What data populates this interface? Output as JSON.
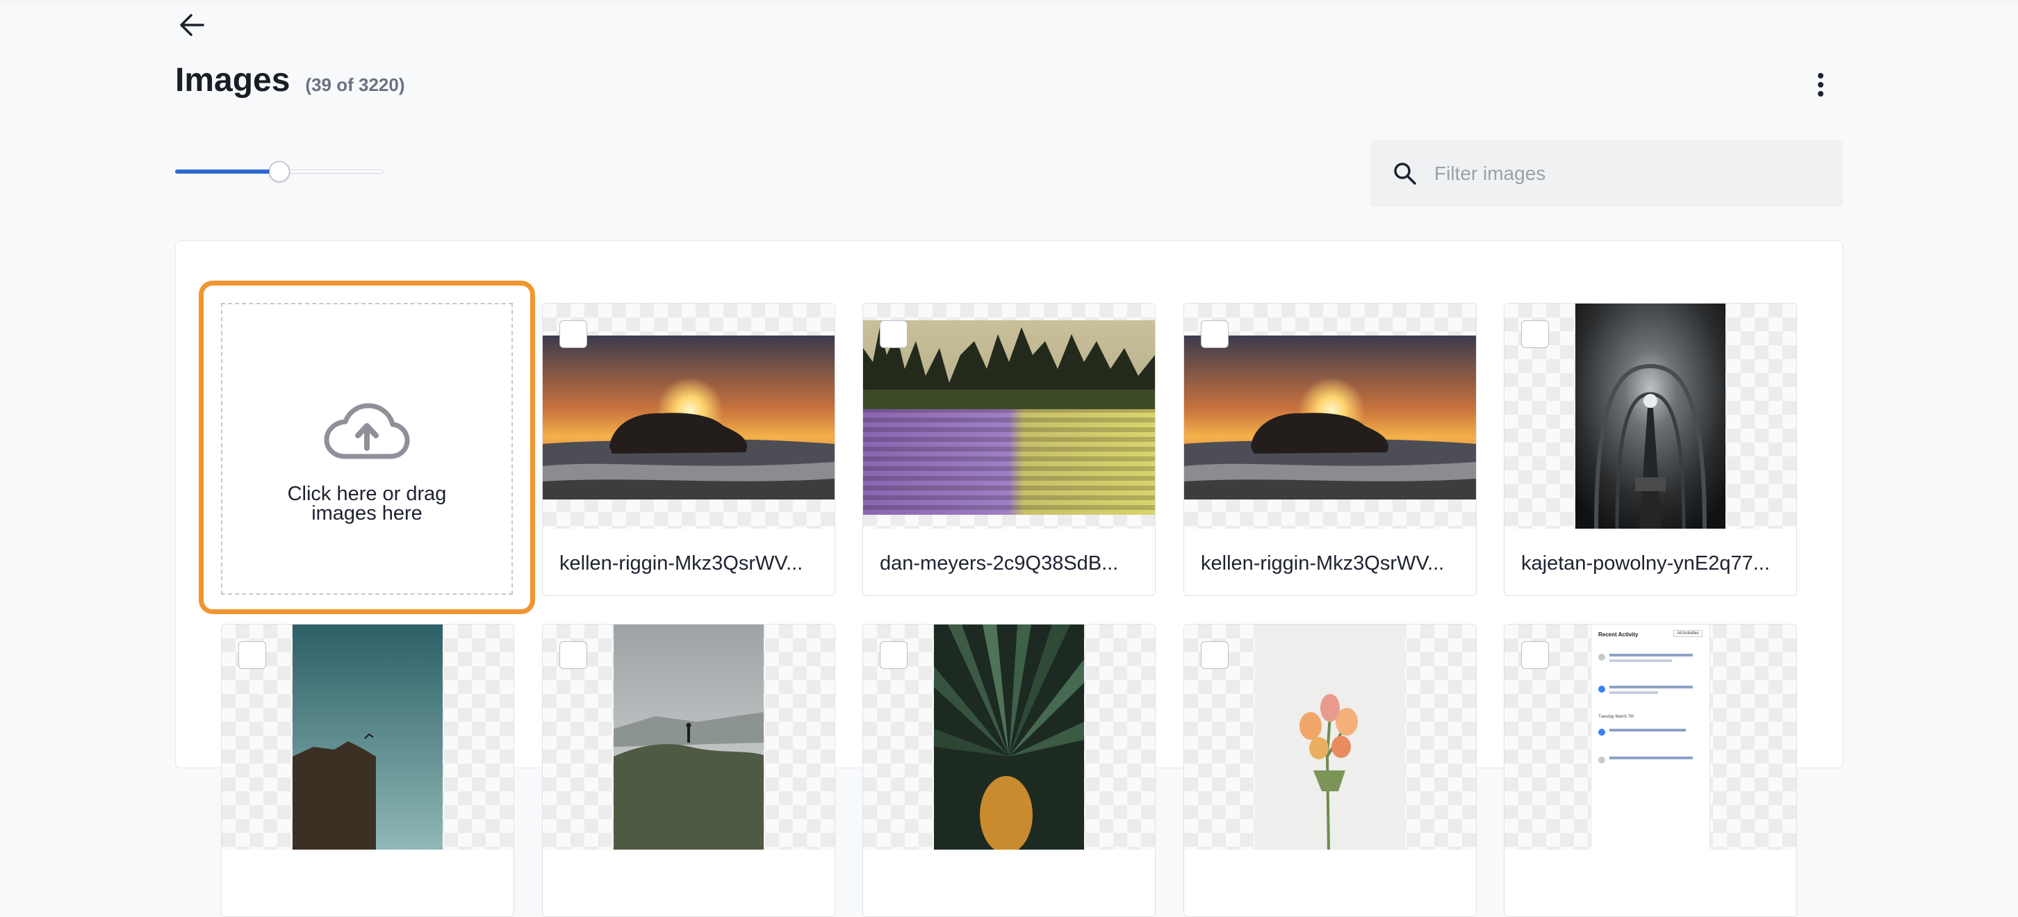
{
  "header": {
    "title": "Images",
    "count": "(39 of 3220)"
  },
  "search": {
    "placeholder": "Filter images",
    "value": ""
  },
  "thumbnail_size": {
    "fraction": 0.5
  },
  "upload": {
    "label": "Click here or drag images here",
    "accent": "#f0952f"
  },
  "images": [
    {
      "filename": "kellen-riggin-Mkz3QsrWV..."
    },
    {
      "filename": "dan-meyers-2c9Q38SdB..."
    },
    {
      "filename": "kellen-riggin-Mkz3QsrWV..."
    },
    {
      "filename": "kajetan-powolny-ynE2q77..."
    },
    {
      "filename": ""
    },
    {
      "filename": ""
    },
    {
      "filename": ""
    },
    {
      "filename": ""
    },
    {
      "filename": ""
    }
  ],
  "thumbnail_preview": {
    "title": "Recent Activity",
    "filter": "All Activities",
    "date": "Tuesday March 7th"
  },
  "colors": {
    "accent_blue": "#2f6ad0",
    "highlight_orange": "#f0952f",
    "background": "#f8f9fb"
  }
}
